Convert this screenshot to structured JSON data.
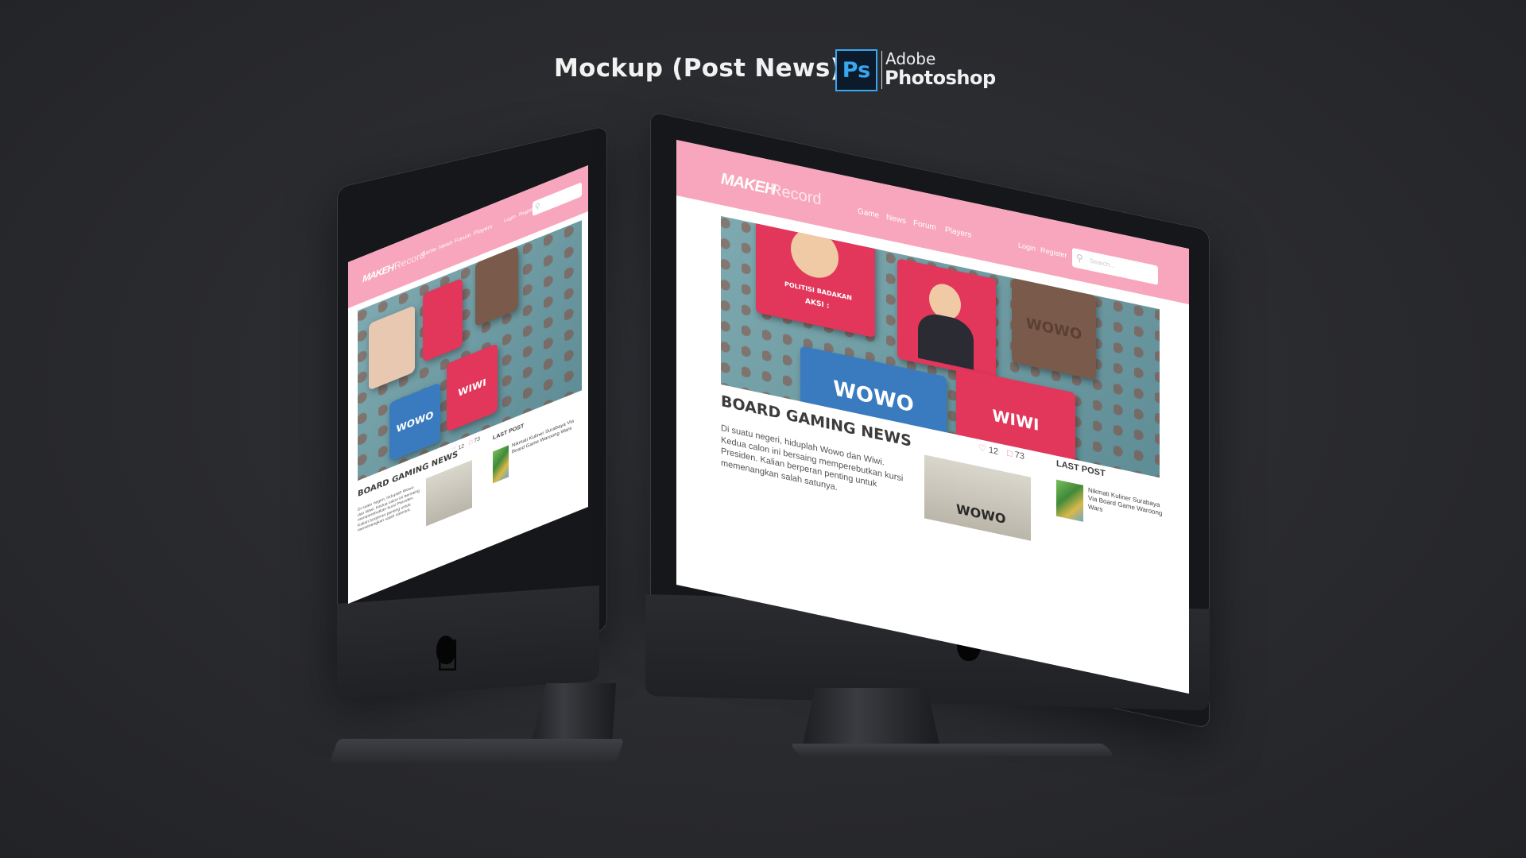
{
  "header": {
    "title": "Mockup (Post News)",
    "ps_icon": "Ps",
    "brand_line1": "Adobe",
    "brand_line2": "Photoshop"
  },
  "site": {
    "logo_bold": "MAKEH",
    "logo_light": "Record",
    "nav": [
      "Game",
      "News",
      "Forum",
      "Players"
    ],
    "login": "Login",
    "register": "Register",
    "search_placeholder": "Search...",
    "hero_cards": {
      "card1_label": "POLITISI BADAKAN",
      "card1_sub": "AKSI :",
      "card3": "WOWO",
      "card4": "WOWO",
      "card5": "WIWI"
    },
    "post_title": "BOARD GAMING NEWS",
    "likes": "12",
    "comments": "73",
    "post_body": "Di suatu negeri, hiduplah Wowo dan Wiwi. Kedua calon ini bersaing memperebutkan kursi Presiden. Kalian berperan penting untuk memenangkan salah satunya.",
    "thumb_text": "WOWO",
    "sidebar_title": "LAST POST",
    "sidebar_post": "Nikmati Kuliner Surabaya Via Board Game Waroong Wars"
  },
  "colors": {
    "nav_pink": "#f7a6bd",
    "card_red": "#e2365a",
    "card_blue": "#3a7bc0",
    "card_brown": "#7a5a4a",
    "ps_blue": "#3aa6ef"
  },
  "icons": [
    "apple-logo-icon",
    "search-icon",
    "like-icon",
    "comment-icon"
  ]
}
